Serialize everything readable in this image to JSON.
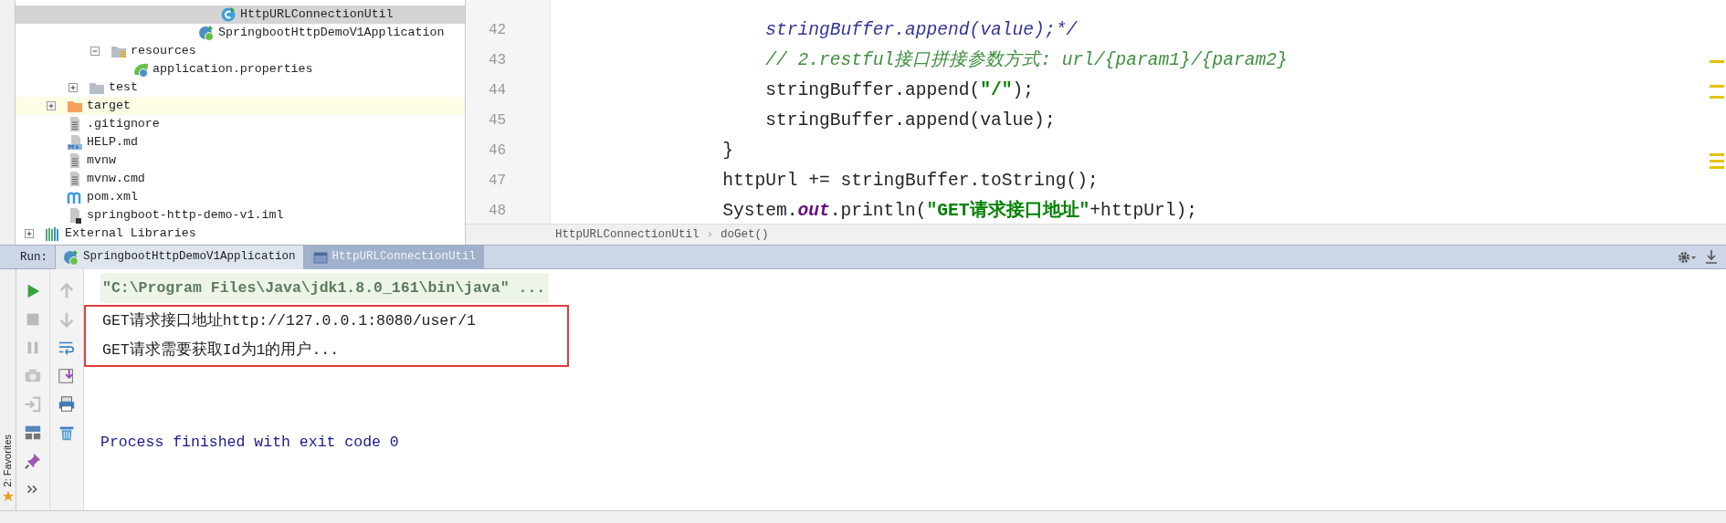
{
  "project_tree": [
    {
      "children": [
        {
          "children": [
            {
              "children": [
                {
                  "children": [
                    {
                      "children": [
                        {
                          "children": [
                            {
                              "children": [
                                {
                                  "children": [
                                    {
                                      "label": "HttpURLConnectionUtil",
                                      "kind": "class",
                                      "selected": true,
                                      "excluded": false
                                    }
                                  ]
                                },
                                {
                                  "label": "SpringbootHttpDemoV1Application",
                                  "kind": "spring-app",
                                  "selected": false,
                                  "excluded": false
                                }
                              ]
                            }
                          ]
                        }
                      ]
                    }
                  ]
                },
                {
                  "label": "resources",
                  "kind": "resources-folder",
                  "selected": false,
                  "excluded": false,
                  "expanded": true,
                  "children": [
                    {
                      "label": "application.properties",
                      "kind": "spring-config",
                      "selected": false,
                      "excluded": false
                    }
                  ]
                }
              ]
            },
            {
              "label": "test",
              "kind": "folder",
              "selected": false,
              "excluded": false,
              "expanded": false
            }
          ]
        },
        {
          "label": "target",
          "kind": "excluded-folder",
          "selected": false,
          "excluded": true,
          "expanded": false
        },
        {
          "label": ".gitignore",
          "kind": "text-file",
          "selected": false,
          "excluded": false
        },
        {
          "label": "HELP.md",
          "kind": "markdown",
          "selected": false,
          "excluded": false
        },
        {
          "label": "mvnw",
          "kind": "text-file",
          "selected": false,
          "excluded": false
        },
        {
          "label": "mvnw.cmd",
          "kind": "text-file",
          "selected": false,
          "excluded": false
        },
        {
          "label": "pom.xml",
          "kind": "maven",
          "selected": false,
          "excluded": false
        },
        {
          "label": "springboot-http-demo-v1.iml",
          "kind": "module-file",
          "selected": false,
          "excluded": false
        }
      ]
    },
    {
      "label": "External Libraries",
      "kind": "library",
      "selected": false,
      "excluded": false,
      "expanded": false
    }
  ],
  "editor": {
    "lines": [
      {
        "number": "42",
        "tokens": [
          {
            "kind": "commented-code",
            "text": "                    stringBuffer.append(value);*/"
          }
        ]
      },
      {
        "number": "43",
        "tokens": [
          {
            "kind": "comment",
            "text": "                    // 2.restful接口拼接参数方式: url/{param1}/{param2}"
          }
        ]
      },
      {
        "number": "44",
        "tokens": [
          {
            "kind": "plain",
            "text": "                    stringBuffer.append("
          },
          {
            "kind": "string",
            "text": "\"/\""
          },
          {
            "kind": "plain",
            "text": ");"
          }
        ]
      },
      {
        "number": "45",
        "tokens": [
          {
            "kind": "plain",
            "text": "                    stringBuffer.append(value);"
          }
        ]
      },
      {
        "number": "46",
        "tokens": [
          {
            "kind": "plain",
            "text": "                }"
          }
        ]
      },
      {
        "number": "47",
        "tokens": [
          {
            "kind": "plain",
            "text": "                httpUrl += stringBuffer.toString();"
          }
        ]
      },
      {
        "number": "48",
        "tokens": [
          {
            "kind": "plain",
            "text": "                System."
          },
          {
            "kind": "static-field",
            "text": "out"
          },
          {
            "kind": "plain",
            "text": ".println("
          },
          {
            "kind": "string",
            "text": "\"GET请求接口地址\""
          },
          {
            "kind": "plain",
            "text": "+httpUrl);"
          }
        ]
      }
    ],
    "breadcrumbs": [
      "HttpURLConnectionUtil",
      "doGet()"
    ],
    "breadcrumb_separator": "›"
  },
  "run_panel": {
    "label": "Run:",
    "tabs": [
      {
        "label": "SpringbootHttpDemoV1Application",
        "kind": "spring-app",
        "selected": false
      },
      {
        "label": "HttpURLConnectionUtil",
        "kind": "window",
        "selected": true
      }
    ],
    "toolbar": [
      {
        "disabled": false
      },
      {
        "disabled": true
      },
      {
        "disabled": true
      },
      {
        "disabled": true
      },
      {
        "disabled": true
      },
      {
        "disabled": false
      },
      {
        "disabled": false
      },
      {
        "disabled": false
      }
    ],
    "side_toolbar": [
      {
        "disabled": true
      },
      {
        "disabled": true
      },
      {
        "disabled": false
      },
      {
        "disabled": false
      },
      {
        "disabled": false
      },
      {
        "disabled": false
      }
    ],
    "console": [
      {
        "kind": "command",
        "text": "\"C:\\Program Files\\Java\\jdk1.8.0_161\\bin\\java\" ...",
        "highlighted": false
      },
      {
        "kind": "output",
        "text": "GET请求接口地址http://127.0.0.1:8080/user/1",
        "highlighted": true
      },
      {
        "kind": "output",
        "text": "GET请求需要获取Id为1的用户...",
        "highlighted": true
      },
      {
        "kind": "exit",
        "text": "Process finished with exit code 0",
        "highlighted": false
      }
    ]
  },
  "favorites_stripe": {
    "label": "2: Favorites"
  }
}
